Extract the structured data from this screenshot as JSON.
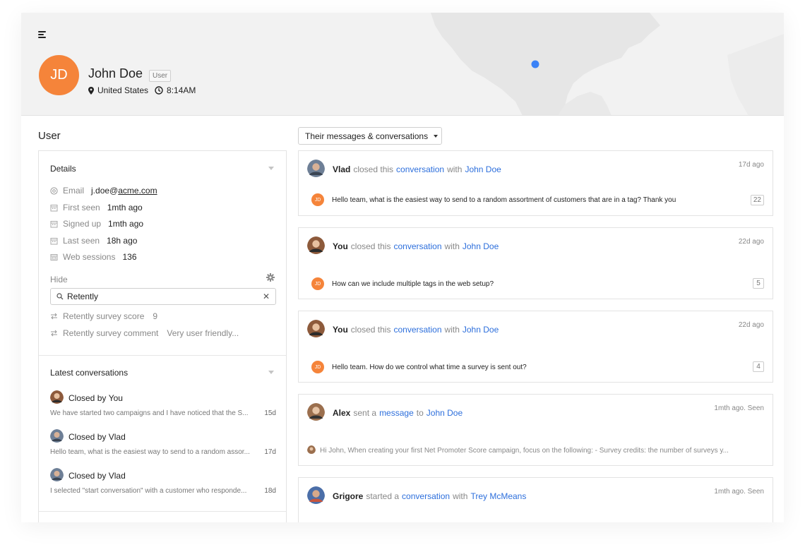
{
  "profile": {
    "initials": "JD",
    "name": "John Doe",
    "role": "User",
    "location": "United States",
    "local_time": "8:14AM"
  },
  "colors": {
    "avatar_orange": "#f5843a",
    "link_blue": "#2d6fdc",
    "map_dot": "#3b82f6"
  },
  "left": {
    "title": "User",
    "details": {
      "title": "Details",
      "rows": [
        {
          "icon": "at-icon",
          "label": "Email",
          "value_prefix": "j.doe@",
          "value_link": "acme.com"
        },
        {
          "icon": "calendar-icon",
          "label": "First seen",
          "value": "1mth ago"
        },
        {
          "icon": "calendar-icon",
          "label": "Signed up",
          "value": "1mth ago"
        },
        {
          "icon": "calendar-icon",
          "label": "Last seen",
          "value": "18h ago"
        },
        {
          "icon": "browser-icon",
          "label": "Web sessions",
          "value": "136"
        }
      ],
      "hide_label": "Hide",
      "search_value": "Retently",
      "attributes": [
        {
          "label": "Retently survey score",
          "value": "9"
        },
        {
          "label": "Retently survey comment",
          "value": "Very user friendly..."
        }
      ]
    },
    "latest": {
      "title": "Latest conversations",
      "items": [
        {
          "prefix": "Closed by",
          "by": "You",
          "snippet": "We have started two campaigns and I have noticed that the S...",
          "ago": "15d"
        },
        {
          "prefix": "Closed by",
          "by": "Vlad",
          "snippet": "Hello team, what is the easiest way to send to a random assor...",
          "ago": "17d"
        },
        {
          "prefix": "Closed by",
          "by": "Vlad",
          "snippet": "I selected \"start conversation\" with a customer who responde...",
          "ago": "18d"
        }
      ]
    }
  },
  "filter": {
    "label": "Their messages & conversations"
  },
  "feed": [
    {
      "actor": "Vlad",
      "verb": "closed this",
      "link1": "conversation",
      "conj": "with",
      "link2": "John Doe",
      "ago": "17d ago",
      "message": "Hello team, what is the easiest way to send to a random assortment of customers that are in a tag? Thank you",
      "count": "22"
    },
    {
      "actor": "You",
      "verb": "closed this",
      "link1": "conversation",
      "conj": "with",
      "link2": "John Doe",
      "ago": "22d ago",
      "message": "How can we include multiple tags in the web setup?",
      "count": "5"
    },
    {
      "actor": "You",
      "verb": "closed this",
      "link1": "conversation",
      "conj": "with",
      "link2": "John Doe",
      "ago": "22d ago",
      "message": "Hello team. How do we control what time a survey is sent out?",
      "count": "4"
    },
    {
      "actor": "Alex",
      "verb": "sent a",
      "link1": "message",
      "conj": "to",
      "link2": "John Doe",
      "ago": "1mth ago. Seen",
      "message": "Hi John, When creating your first Net Promoter Score campaign, focus on the following: - Survey credits: the number of surveys y..."
    },
    {
      "actor": "Grigore",
      "verb": "started a",
      "link1": "conversation",
      "conj": "with",
      "link2": "Trey McMeans",
      "ago": "1mth ago. Seen"
    }
  ]
}
